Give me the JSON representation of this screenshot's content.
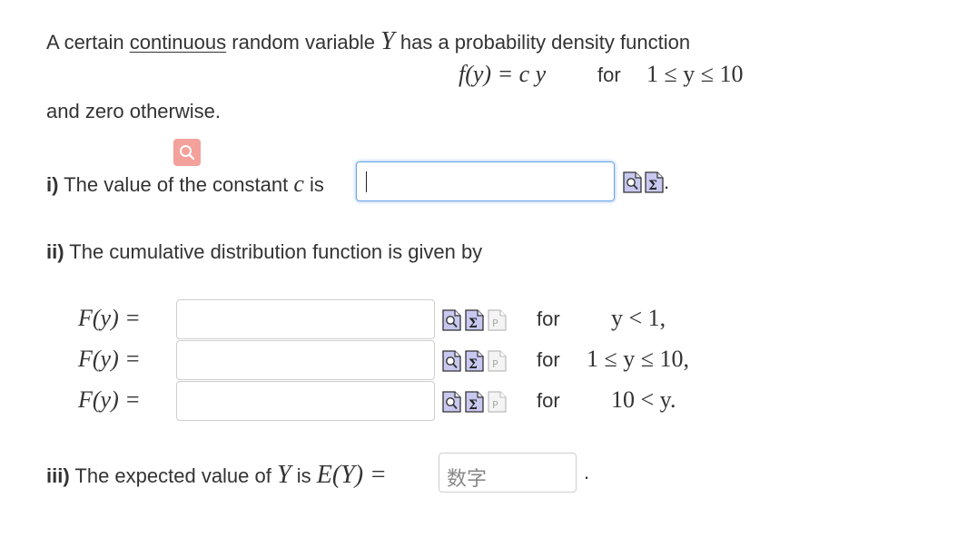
{
  "intro": {
    "part1": "A certain",
    "link_text": "continuous",
    "part2": "random variable",
    "var": "Y",
    "part3": "has a probability density function"
  },
  "pdf": {
    "lhs": "f(y) = c y",
    "for": "for",
    "range": "1 ≤ y ≤ 10"
  },
  "otherwise": "and zero otherwise.",
  "part_i": {
    "label": "i)",
    "text": "The value of the constant",
    "const": "c",
    "is": "is",
    "value": "",
    "trail": "."
  },
  "part_ii": {
    "label": "ii)",
    "text": "The cumulative distribution function is given by",
    "rows": [
      {
        "lhs": "F(y) =",
        "value": "",
        "for": "for",
        "cond": "y < 1,"
      },
      {
        "lhs": "F(y) =",
        "value": "",
        "for": "for",
        "cond": "1 ≤ y ≤ 10,"
      },
      {
        "lhs": "F(y) =",
        "value": "",
        "for": "for",
        "cond": "10 < y."
      }
    ]
  },
  "part_iii": {
    "label": "iii)",
    "text": "The expected value of",
    "var": "Y",
    "is": "is",
    "expr": "E(Y) =",
    "placeholder": "数字",
    "trail": "."
  },
  "icons": {
    "magnify": "magnifier-icon",
    "preview": "preview-icon",
    "equation": "sigma-icon",
    "paste": "paste-icon"
  },
  "colors": {
    "text": "#333333",
    "focus": "#6aa5e6",
    "magnifier_bg": "#f4a09b",
    "icon_fill": "#c8c8f0"
  }
}
